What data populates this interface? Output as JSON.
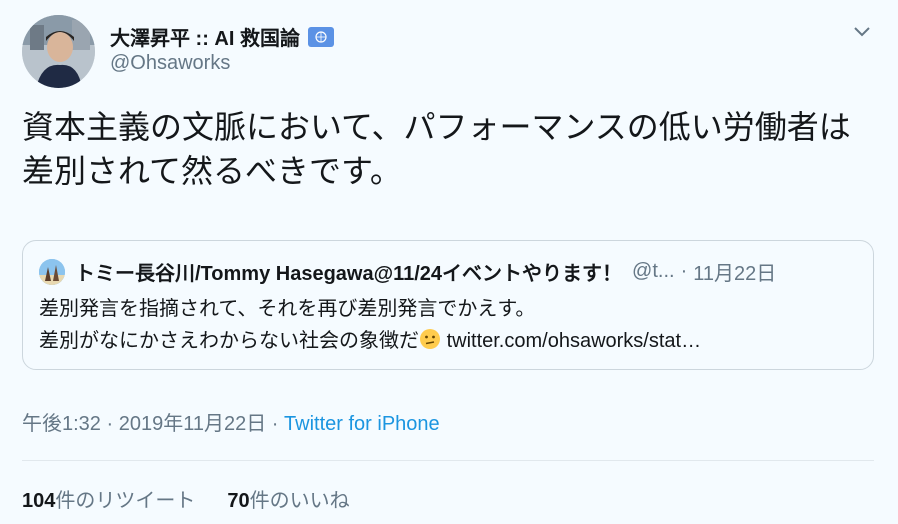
{
  "author": {
    "name": "大澤昇平 :: AI 救国論",
    "handle": "@Ohsaworks"
  },
  "tweet": {
    "text": "資本主義の文脈において、パフォーマンスの低い労働者は差別されて然るべきです。"
  },
  "quoted": {
    "name": "トミー長谷川/Tommy Hasegawa@11/24イベントやります！",
    "handle": "@t...",
    "separator": "·",
    "date": "11月22日",
    "line1": "差別発言を指摘されて、それを再び差別発言でかえす。",
    "line2": "差別がなにかさえわからない社会の象徴だ",
    "link": "twitter.com/ohsaworks/stat…"
  },
  "meta": {
    "time": "午後1:32",
    "sep1": "·",
    "date": "2019年11月22日",
    "sep2": "·",
    "source": "Twitter for iPhone"
  },
  "stats": {
    "retweets_count": "104",
    "retweets_label": "件のリツイート",
    "likes_count": "70",
    "likes_label": "件のいいね"
  },
  "colors": {
    "background": "#f5fbff",
    "link": "#1b95e0",
    "muted": "#657786",
    "badge": "#5b92e5"
  },
  "icons": [
    "un-flag-icon",
    "chevron-down-icon",
    "confused-face-emoji"
  ]
}
